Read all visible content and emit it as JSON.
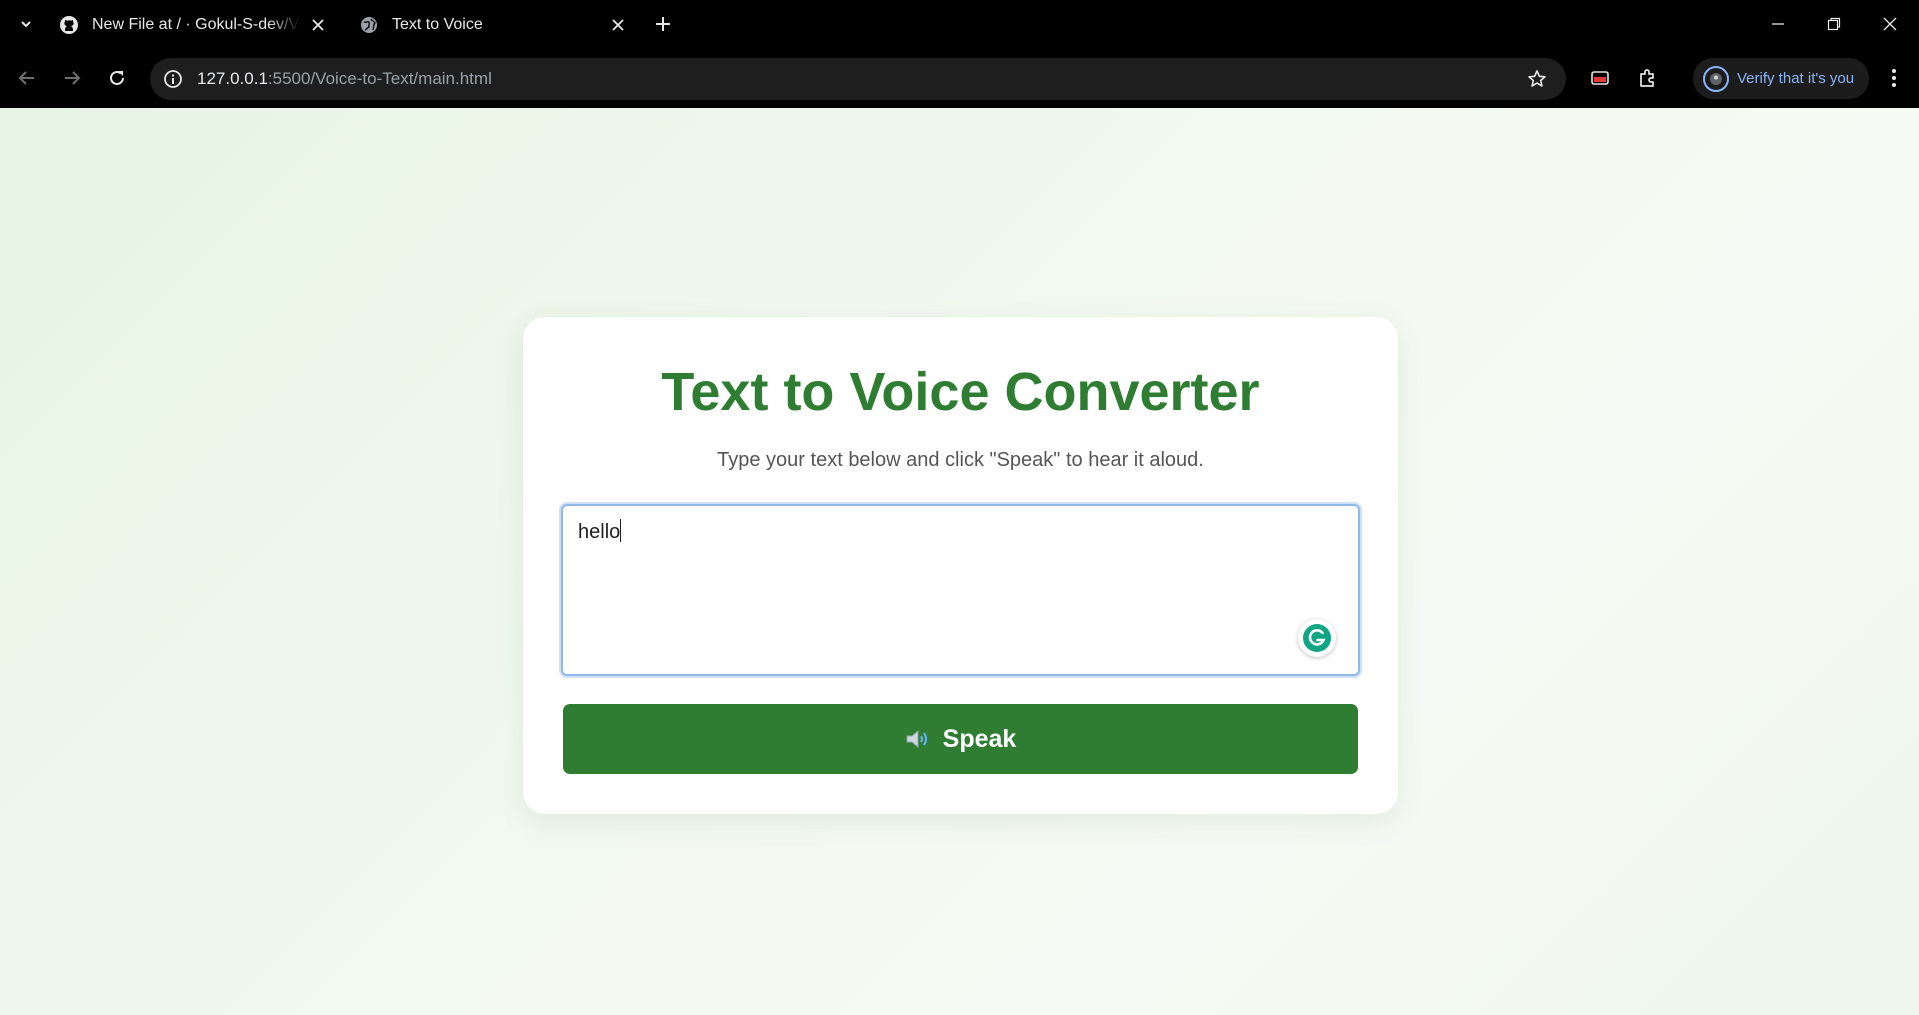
{
  "browser": {
    "tabs": [
      {
        "title": "New File at / · Gokul-S-dev/Voice-to-Text",
        "favicon": "github-icon",
        "active": false
      },
      {
        "title": "Text to Voice",
        "favicon": "globe-icon",
        "active": true
      }
    ],
    "url": {
      "host": "127.0.0.1",
      "rest": ":5500/Voice-to-Text/main.html"
    },
    "profile_label": "Verify that it's you"
  },
  "page": {
    "title": "Text to Voice Converter",
    "subtitle": "Type your text below and click \"Speak\" to hear it aloud.",
    "textarea_value": "hello",
    "speak_label": "Speak",
    "speak_icon": "speaker-icon"
  },
  "colors": {
    "accent": "#2e7d32",
    "page_bg": "#eef7ec",
    "chrome_bg": "#000000",
    "link_blue": "#8ab4f8"
  }
}
